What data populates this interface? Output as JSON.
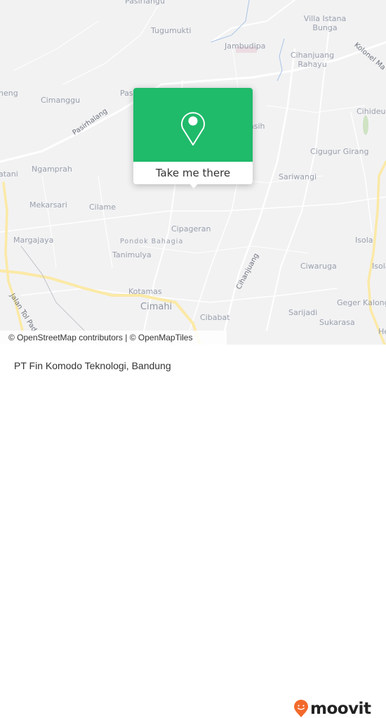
{
  "map": {
    "labels": {
      "pasirlangu": "Pasirlangu",
      "tugumukti": "Tugumukti",
      "villa_istana_bunga_1": "Villa Istana",
      "villa_istana_bunga_2": "Bunga",
      "jambudipa": "Jambudipa",
      "cihanjuang_rahayu_1": "Cihanjuang",
      "cihanjuang_rahayu_2": "Rahayu",
      "kolonel_road": "Kolonel Ma",
      "ngeng": "neng",
      "cimanggu": "Cimanggu",
      "pas": "Pas",
      "pasirhalang_road": "Pasirhalang",
      "pasih": "asih",
      "cihideung": "Cihideun",
      "cigugur_girang": "Cigugur Girang",
      "batani": "atani",
      "ngamprah": "Ngamprah",
      "sariwangi": "Sariwangi",
      "mekarsari": "Mekarsari",
      "cilame": "Cilame",
      "cipageran": "Cipageran",
      "pondok_bahagia": "Pondok Bahagia",
      "margajaya": "Margajaya",
      "tanimulya": "Tanimulya",
      "isola_1": "Isola",
      "isola_2": "Isola",
      "cihanjuang_road": "Cihanjuang",
      "ciwaruga": "Ciwaruga",
      "kotamas": "Kotamas",
      "jalan_tol_road": "Jalan Tol Pad",
      "cimahi": "Cimahi",
      "cibabat": "Cibabat",
      "geger_kalong": "Geger Kalong",
      "sarijadi": "Sarijadi",
      "sukarasa": "Sukarasa",
      "he": "He"
    },
    "attribution": "© OpenStreetMap contributors | © OpenMapTiles",
    "colors": {
      "background": "#f2f2f3",
      "road": "#ffffff",
      "highway": "#fbe9a6",
      "water": "#a9c4e6",
      "park": "#cfe3c3",
      "label": "#9aa0ad"
    }
  },
  "popup": {
    "action_label": "Take me there",
    "icon": "map-pin-icon",
    "color": "#1fba6a"
  },
  "footer": {
    "place_name": "PT Fin Komodo Teknologi, Bandung",
    "brand": "moovit",
    "brand_color": "#f26a2b"
  }
}
